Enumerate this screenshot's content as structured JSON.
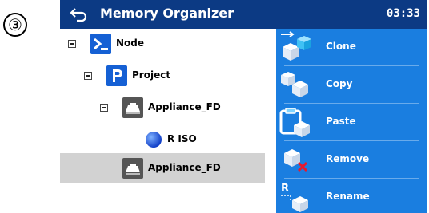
{
  "step_marker": "③",
  "titlebar": {
    "title": "Memory Organizer",
    "time": "03:33",
    "back_icon": "back-arrow-icon",
    "color": "#0c3a84"
  },
  "tree": {
    "items": [
      {
        "label": "Node",
        "icon": "terminal-node-icon",
        "expanded": true
      },
      {
        "label": "Project",
        "icon": "project-icon",
        "expanded": true
      },
      {
        "label": "Appliance_FD",
        "icon": "appliance-icon",
        "expanded": true
      },
      {
        "label": "R ISO",
        "icon": "measurement-dot-icon"
      },
      {
        "label": "Appliance_FD",
        "icon": "appliance-icon",
        "selected": true
      }
    ]
  },
  "actions": {
    "color": "#1a7ee0",
    "items": [
      {
        "label": "Clone",
        "icon": "clone-icon"
      },
      {
        "label": "Copy",
        "icon": "copy-icon"
      },
      {
        "label": "Paste",
        "icon": "paste-icon"
      },
      {
        "label": "Remove",
        "icon": "remove-icon"
      },
      {
        "label": "Rename",
        "icon": "rename-icon"
      }
    ]
  }
}
